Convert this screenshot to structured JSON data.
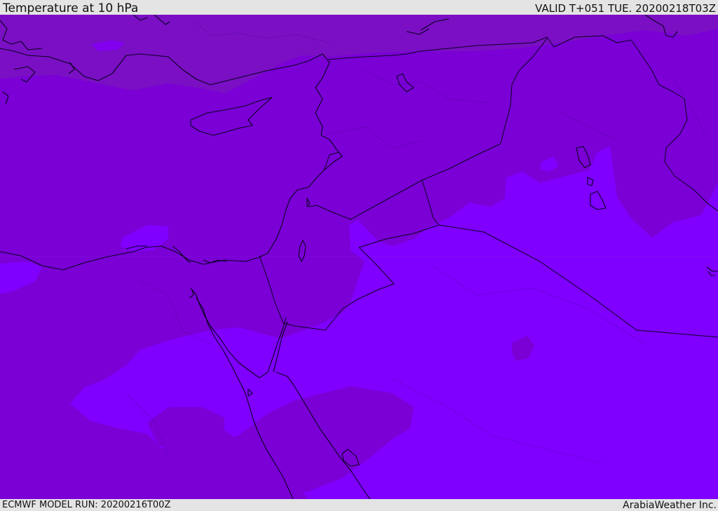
{
  "header": {
    "title": "Temperature at 10 hPa",
    "valid_time": "VALID T+051 TUE. 20200218T03Z"
  },
  "footer": {
    "model_run": "ECMWF MODEL RUN: 20200216T00Z",
    "credit": "ArabiaWeather Inc."
  },
  "map": {
    "shading_colors": {
      "cold_band": "#7a00d6",
      "north_band": "#7a0fc4",
      "warm_band": "#7f00ff",
      "intermediate": "#8100ef"
    },
    "line_colors": {
      "coastline": "#0a0020",
      "border": "#0a0020"
    }
  }
}
